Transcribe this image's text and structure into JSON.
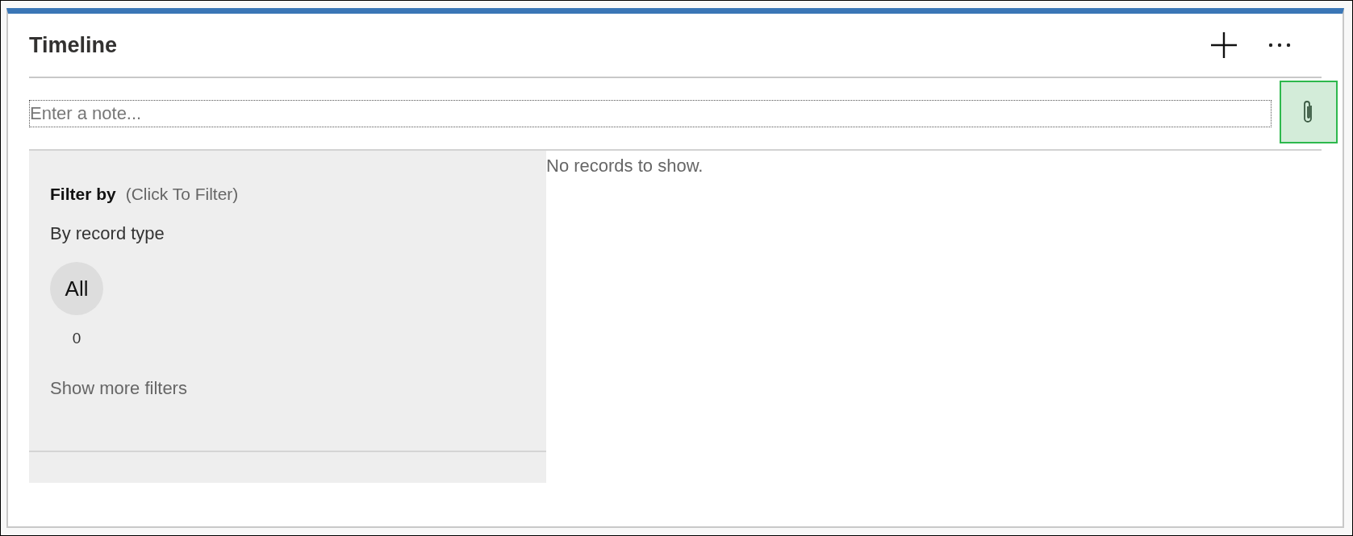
{
  "header": {
    "title": "Timeline"
  },
  "note": {
    "placeholder": "Enter a note..."
  },
  "filter": {
    "heading": "Filter by",
    "hint": "(Click To Filter)",
    "group_label": "By record type",
    "chips": [
      {
        "label": "All",
        "count": "0"
      }
    ],
    "more_link": "Show more filters"
  },
  "records": {
    "empty_message": "No records to show."
  }
}
